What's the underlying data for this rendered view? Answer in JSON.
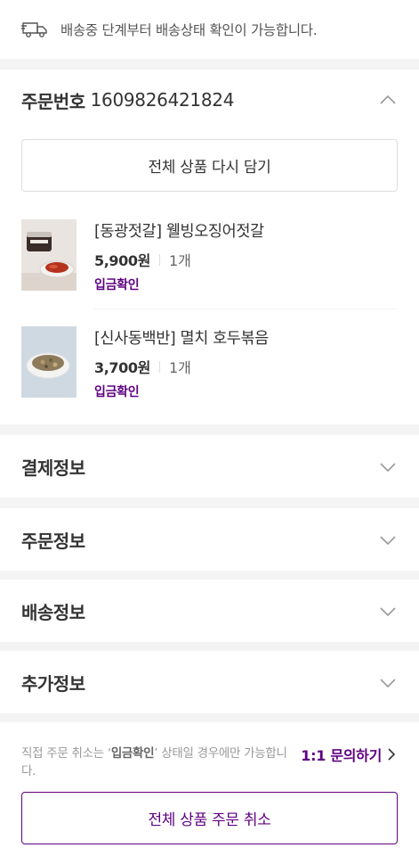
{
  "notice": {
    "icon": "truck-icon",
    "text": "배송중 단계부터 배송상태 확인이 가능합니다."
  },
  "order": {
    "label": "주문번호",
    "number": "1609826421824",
    "expanded": true,
    "reorder_label": "전체 상품 다시 담기",
    "items": [
      {
        "name": "[동광젓갈] 웰빙오징어젓갈",
        "price": "5,900원",
        "qty": "1개",
        "status": "입금확인",
        "image": "squid-jeotgal-photo"
      },
      {
        "name": "[신사동백반] 멸치 호두볶음",
        "price": "3,700원",
        "qty": "1개",
        "status": "입금확인",
        "image": "anchovy-walnut-photo"
      }
    ]
  },
  "sections": [
    {
      "title": "결제정보",
      "expanded": false
    },
    {
      "title": "주문정보",
      "expanded": false
    },
    {
      "title": "배송정보",
      "expanded": false
    },
    {
      "title": "추가정보",
      "expanded": false
    }
  ],
  "footer": {
    "help_prefix": "직접 주문 취소는 ‘",
    "help_bold": "입금확인",
    "help_suffix": "’ 상태일 경우에만 가능합니다.",
    "inquiry_label": "1:1 문의하기",
    "cancel_label": "전체 상품 주문 취소"
  },
  "colors": {
    "accent": "#5f0080",
    "divider": "#f4f4f4",
    "border": "#dddddd"
  }
}
